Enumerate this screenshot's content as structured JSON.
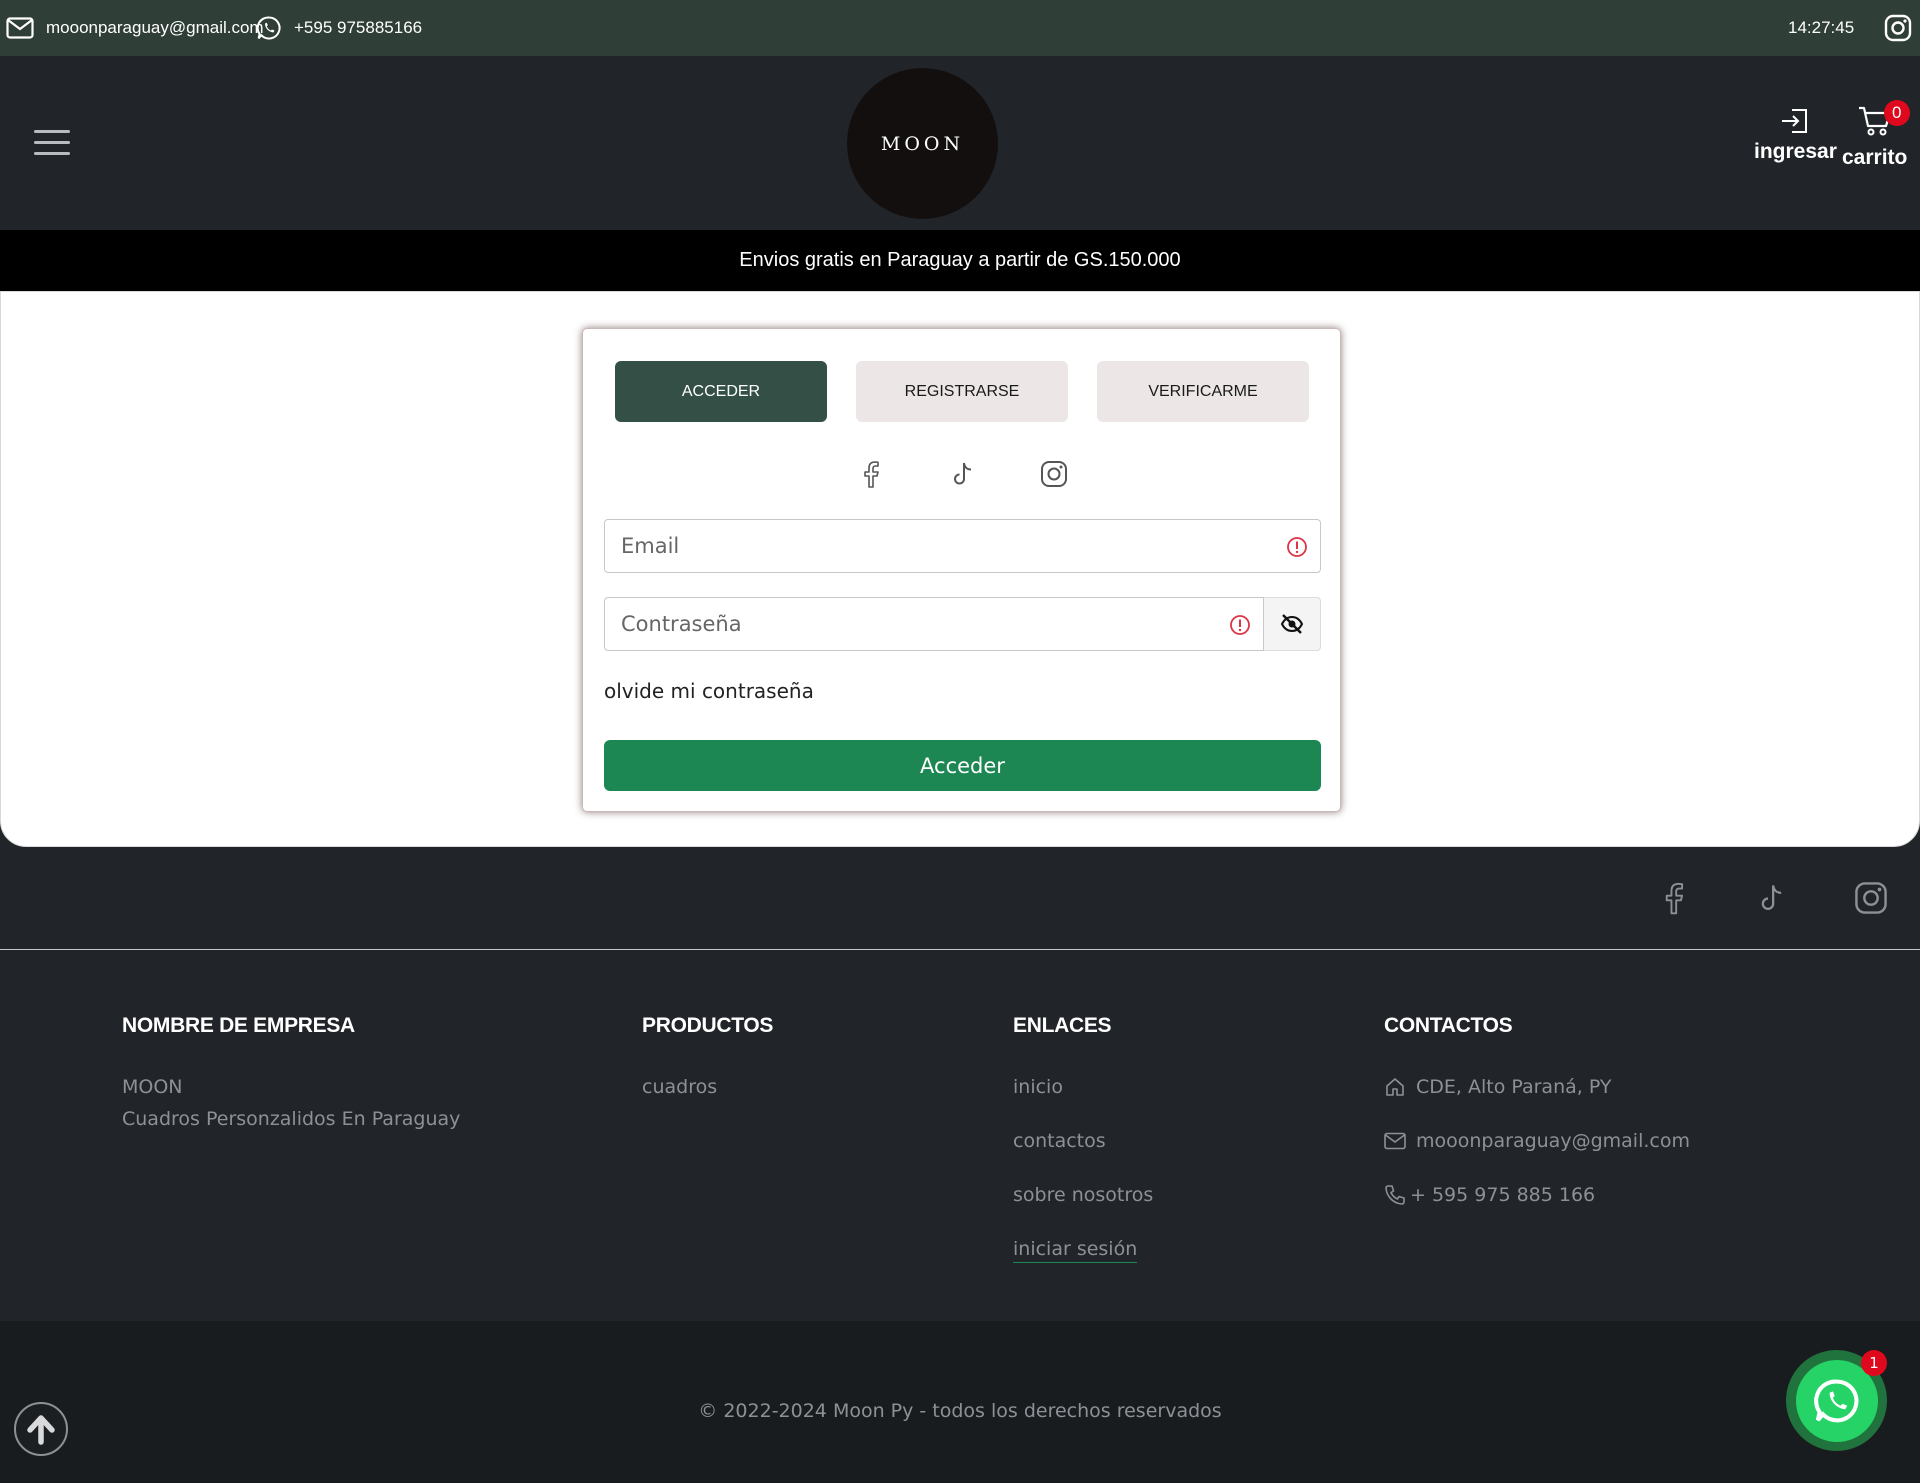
{
  "topbar": {
    "email": "mooonparaguay@gmail.com",
    "phone": "+595 975885166",
    "time": "14:27:45"
  },
  "header": {
    "logo_text": "MOON",
    "login_label": "ingresar",
    "cart_label": "carrito",
    "cart_count": "0"
  },
  "promo": {
    "text": "Envios gratis en Paraguay a partir de GS.150.000"
  },
  "auth": {
    "tabs": [
      {
        "label": "ACCEDER",
        "active": true
      },
      {
        "label": "REGISTRARSE",
        "active": false
      },
      {
        "label": "VERIFICARME",
        "active": false
      }
    ],
    "email_placeholder": "Email",
    "password_placeholder": "Contraseña",
    "forgot_label": "olvide mi contraseña",
    "submit_label": "Acceder"
  },
  "footer": {
    "company": {
      "heading": "NOMBRE DE EMPRESA",
      "name": "MOON",
      "tagline": "Cuadros Personzalidos En Paraguay"
    },
    "products": {
      "heading": "PRODUCTOS",
      "items": [
        "cuadros"
      ]
    },
    "links": {
      "heading": "ENLACES",
      "items": [
        "inicio",
        "contactos",
        "sobre nosotros",
        "iniciar sesión"
      ]
    },
    "contacts": {
      "heading": "CONTACTOS",
      "address": "CDE, Alto Paraná, PY",
      "email": "mooonparaguay@gmail.com",
      "phone": "+ 595 975 885 166"
    },
    "copyright": "© 2022-2024 Moon Py - todos los derechos reservados"
  },
  "whatsapp": {
    "badge": "1"
  },
  "colors": {
    "topbar": "#2f3e37",
    "accent_dark": "#345046",
    "primary": "#1d8754",
    "danger": "#e0081c",
    "footer": "#212529"
  }
}
